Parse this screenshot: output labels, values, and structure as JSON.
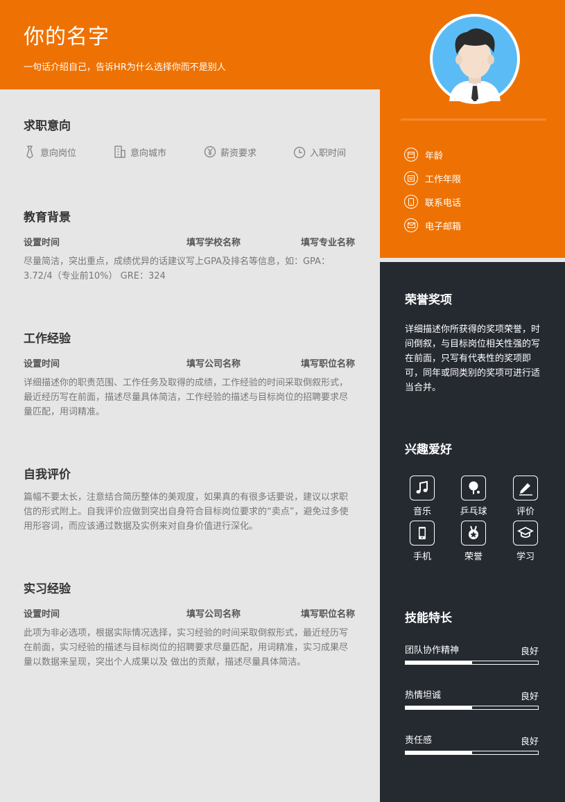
{
  "header": {
    "name": "你的名字",
    "tagline": "一句话介绍自己，告诉HR为什么选择你而不是别人"
  },
  "basic_info": [
    {
      "icon": "calendar-icon",
      "label": "年龄"
    },
    {
      "icon": "briefcase-calendar-icon",
      "label": "工作年限"
    },
    {
      "icon": "phone-icon",
      "label": "联系电话"
    },
    {
      "icon": "mail-icon",
      "label": "电子邮箱"
    }
  ],
  "job_intent": {
    "title": "求职意向",
    "items": [
      {
        "icon": "tie-icon",
        "label": "意向岗位"
      },
      {
        "icon": "building-icon",
        "label": "意向城市"
      },
      {
        "icon": "yen-icon",
        "label": "薪资要求"
      },
      {
        "icon": "clock-icon",
        "label": "入职时间"
      }
    ]
  },
  "education": {
    "title": "教育背景",
    "time": "设置时间",
    "org": "填写学校名称",
    "role": "填写专业名称",
    "desc": "尽量简洁，突出重点，成绩优异的话建议写上GPA及排名等信息，如：GPA：3.72/4（专业前10%） GRE：324"
  },
  "work": {
    "title": "工作经验",
    "time": "设置时间",
    "org": "填写公司名称",
    "role": "填写职位名称",
    "desc": "详细描述你的职责范围、工作任务及取得的成绩，工作经验的时间采取倒叙形式，最近经历写在前面，描述尽量具体简洁，工作经验的描述与目标岗位的招聘要求尽量匹配，用词精准。"
  },
  "self_eval": {
    "title": "自我评价",
    "desc": "篇幅不要太长，注意结合简历整体的美观度，如果真的有很多话要说，建议以求职信的形式附上。自我评价应做到突出自身符合目标岗位要求的“卖点”，避免过多使用形容词，而应该通过数据及实例来对自身价值进行深化。"
  },
  "internship": {
    "title": "实习经验",
    "time": "设置时间",
    "org": "填写公司名称",
    "role": "填写职位名称",
    "desc": "此项为非必选项，根据实际情况选择，实习经验的时间采取倒叙形式，最近经历写在前面，实习经验的描述与目标岗位的招聘要求尽量匹配，用词精准，实习成果尽量以数据来呈现，突出个人成果以及 做出的贡献，描述尽量具体简洁。"
  },
  "honors": {
    "title": "荣誉奖项",
    "desc": "详细描述你所获得的奖项荣誉，时间倒叙，与目标岗位相关性强的写在前面，只写有代表性的奖项即可，同年或同类别的奖项可进行适当合并。"
  },
  "hobbies": {
    "title": "兴趣爱好",
    "items": [
      {
        "icon": "music-icon",
        "label": "音乐"
      },
      {
        "icon": "ping-pong-icon",
        "label": "乒乓球"
      },
      {
        "icon": "pen-icon",
        "label": "评价"
      },
      {
        "icon": "mobile-icon",
        "label": "手机"
      },
      {
        "icon": "medal-icon",
        "label": "荣誉"
      },
      {
        "icon": "graduation-cap-icon",
        "label": "学习"
      }
    ]
  },
  "skills": {
    "title": "技能特长",
    "items": [
      {
        "name": "团队协作精神",
        "level": "良好",
        "fill": 0.5
      },
      {
        "name": "热情坦诚",
        "level": "良好",
        "fill": 0.5
      },
      {
        "name": "责任感",
        "level": "良好",
        "fill": 0.5
      }
    ]
  }
}
